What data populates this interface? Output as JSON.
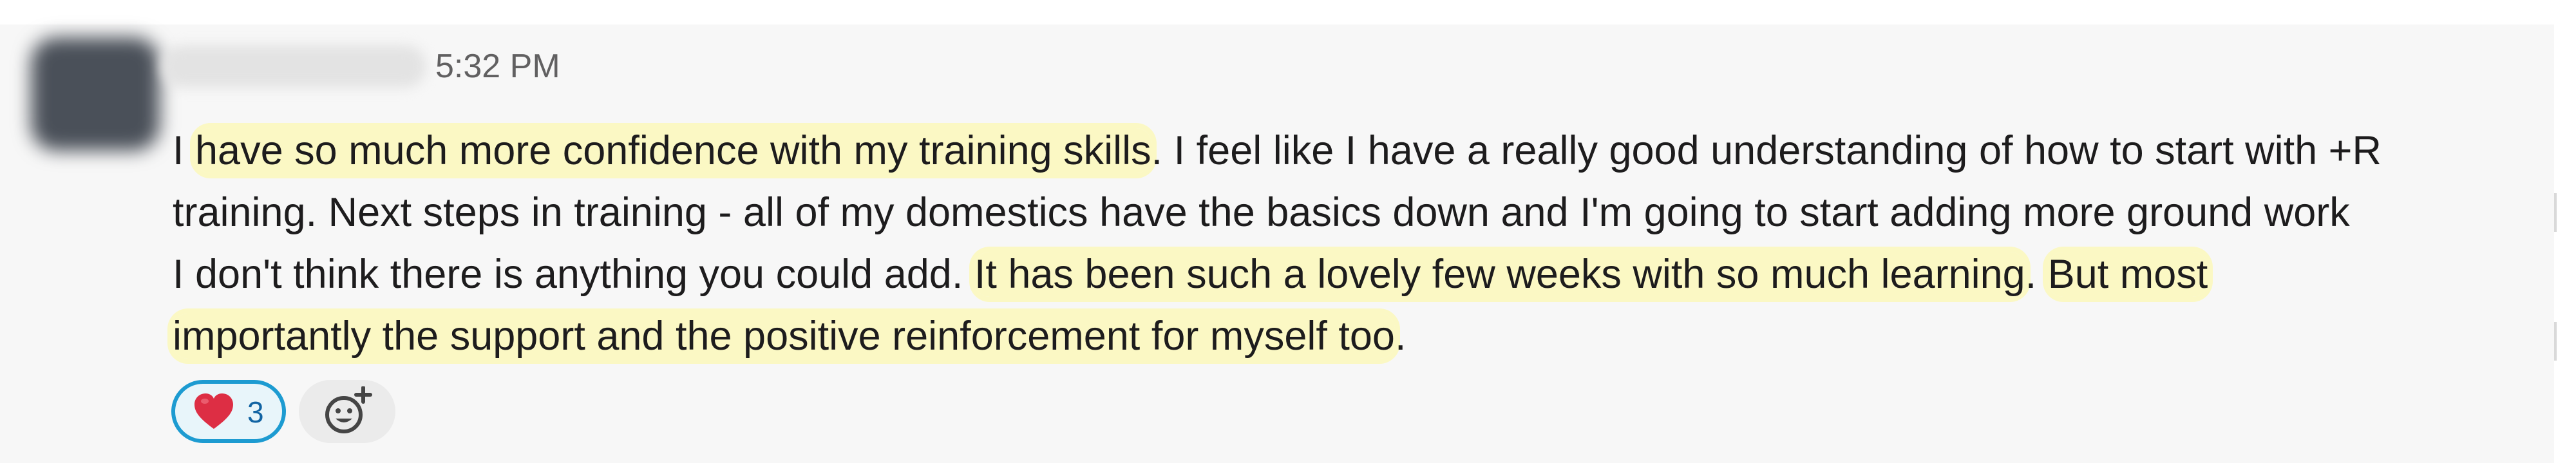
{
  "message": {
    "sender_name": "",
    "timestamp": "5:32 PM",
    "lines": [
      [
        {
          "text": "I ",
          "highlight": false
        },
        {
          "text": "have so much more confidence with my training skills",
          "highlight": true
        },
        {
          "text": ". I feel like I have a really good understanding of how to start with +R",
          "highlight": false
        }
      ],
      [
        {
          "text": "training. Next steps in training - all of my domestics have the basics down and I'm going to start adding more ground work",
          "highlight": false
        }
      ],
      [
        {
          "text": "I don't think there is anything you could add. ",
          "highlight": false
        },
        {
          "text": "It has been such a lovely few weeks with so much learning",
          "highlight": true
        },
        {
          "text": ". ",
          "highlight": false
        },
        {
          "text": "But most",
          "highlight": true
        }
      ],
      [
        {
          "text": "importantly the support and the positive reinforcement for myself too",
          "highlight": true
        },
        {
          "text": ".",
          "highlight": false
        }
      ]
    ]
  },
  "reactions": [
    {
      "emoji": "heart-icon",
      "count": "3",
      "selected": true
    }
  ],
  "add_reaction": {
    "icon": "add-reaction-icon"
  },
  "colors": {
    "highlight": "#fbf8c4",
    "reaction_border": "#1d9bd1",
    "reaction_count": "#1264a3",
    "text": "#1d1c1d",
    "timestamp": "#616061"
  }
}
